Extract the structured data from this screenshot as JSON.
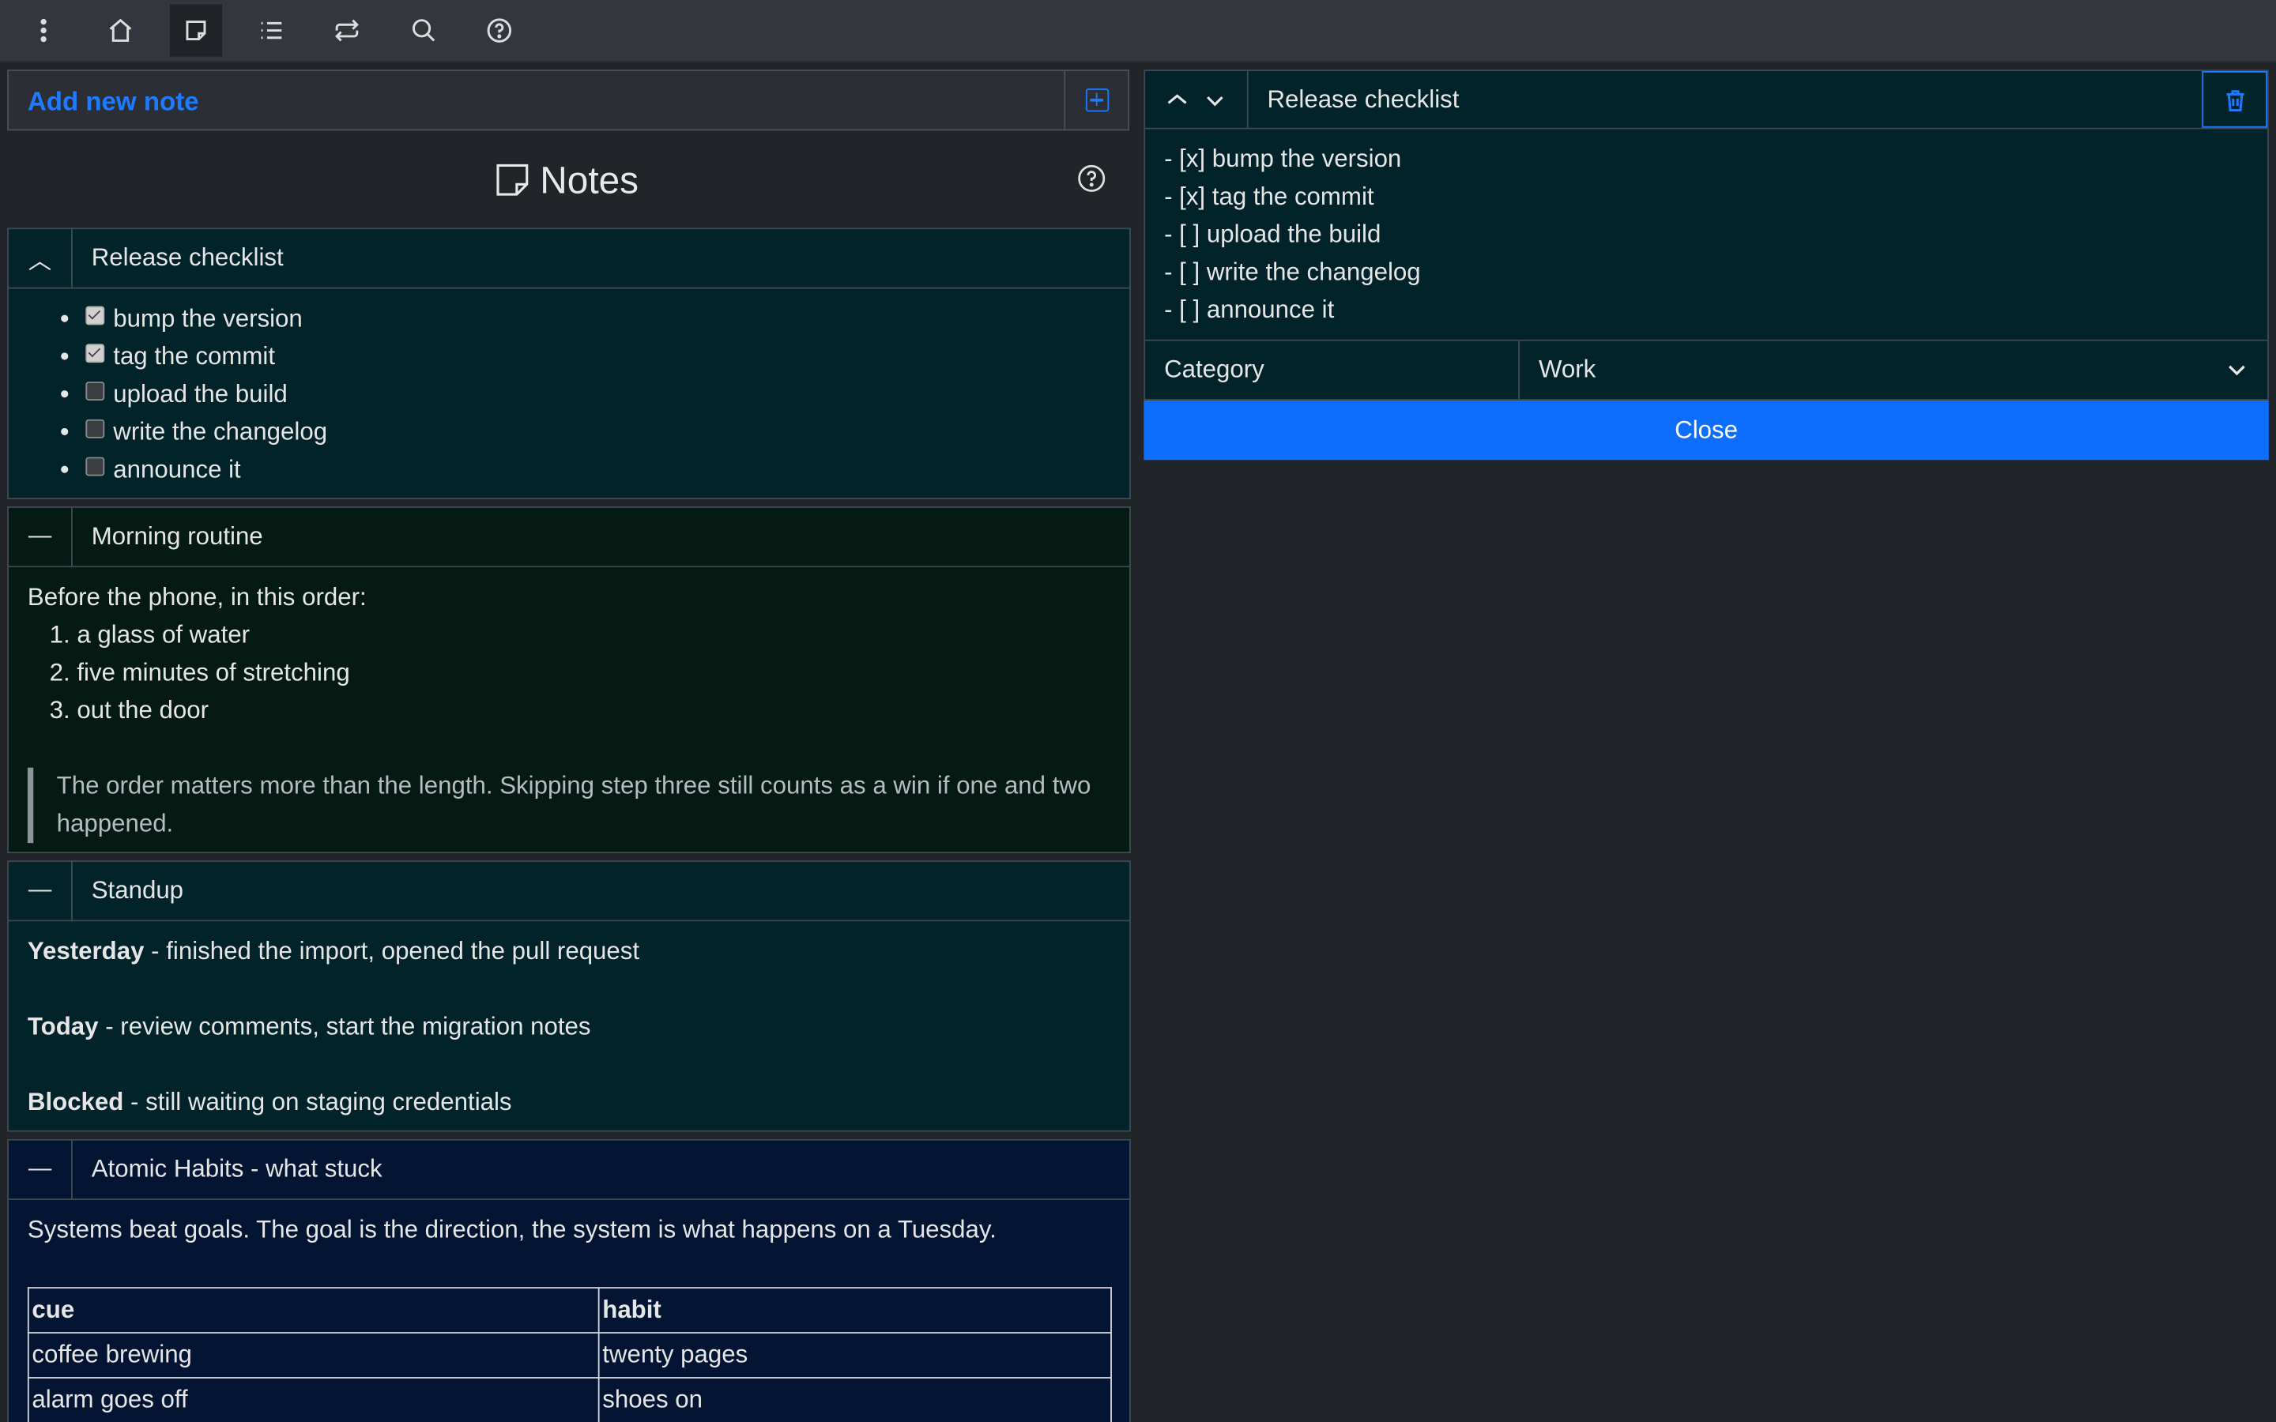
{
  "toolbar": {
    "items": [
      {
        "name": "more",
        "icon": "more-vertical-icon"
      },
      {
        "name": "home",
        "icon": "home-icon"
      },
      {
        "name": "notes",
        "icon": "note-icon",
        "active": true
      },
      {
        "name": "list",
        "icon": "list-icon"
      },
      {
        "name": "sync",
        "icon": "repeat-icon"
      },
      {
        "name": "search",
        "icon": "search-icon"
      },
      {
        "name": "help",
        "icon": "help-icon"
      }
    ]
  },
  "add_note": {
    "label": "Add new note",
    "icon": "plus-square-icon"
  },
  "page": {
    "title": "Notes",
    "title_icon": "note-icon",
    "help_icon": "help-icon"
  },
  "notes": [
    {
      "title": "Release checklist",
      "toggle": "︿",
      "background": "#022329",
      "checklist": [
        {
          "text": "bump the version",
          "checked": true
        },
        {
          "text": "tag the commit",
          "checked": true
        },
        {
          "text": "upload the build",
          "checked": false
        },
        {
          "text": "write the changelog",
          "checked": false
        },
        {
          "text": "announce it",
          "checked": false
        }
      ]
    },
    {
      "title": "Morning routine",
      "toggle": "—",
      "background": "#041a12",
      "intro": "Before the phone, in this order:",
      "steps": [
        "a glass of water",
        "five minutes of stretching",
        "out the door"
      ],
      "quote": "The order matters more than the length. Skipping step three still counts as a win if one and two happened."
    },
    {
      "title": "Standup",
      "toggle": "—",
      "background": "#022329",
      "entries": [
        {
          "label": "Yesterday",
          "text": " - finished the import, opened the pull request"
        },
        {
          "label": "Today",
          "text": " - review comments, start the migration notes"
        },
        {
          "label": "Blocked",
          "text": " - still waiting on staging credentials"
        }
      ]
    },
    {
      "title": "Atomic Habits - what stuck",
      "toggle": "—",
      "background": "#031533",
      "intro": "Systems beat goals. The goal is the direction, the system is what happens on a Tuesday.",
      "table": {
        "headers": [
          "cue",
          "habit"
        ],
        "rows": [
          [
            "coffee brewing",
            "twenty pages"
          ],
          [
            "alarm goes off",
            "shoes on"
          ],
          [
            "",
            ""
          ]
        ]
      }
    }
  ],
  "editor": {
    "title": "Release checklist",
    "lines": [
      "- [x] bump the version",
      "- [x] tag the commit",
      "- [ ] upload the build",
      "- [ ] write the changelog",
      "- [ ] announce it"
    ],
    "category_label": "Category",
    "category_value": "Work",
    "close_label": "Close",
    "delete_icon": "trash-icon"
  },
  "colors": {
    "accent": "#1e7bff",
    "primary_button": "#0d6efd",
    "background": "#212429",
    "topbar": "#33363d"
  }
}
